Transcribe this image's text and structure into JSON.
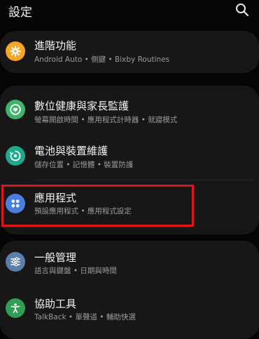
{
  "header": {
    "title": "設定",
    "search_icon": "search-icon"
  },
  "items": [
    {
      "label": "進階功能",
      "sub": "Android Auto • 側鍵 • Bixby Routines",
      "icon": "star-gear-icon",
      "color": "#f6a623"
    },
    {
      "label": "數位健康與家長監護",
      "sub": "螢幕開啟時間 • 應用程式計時器 • 就寢模式",
      "icon": "heart-circle-icon",
      "color": "#3db56a"
    },
    {
      "label": "電池與裝置維護",
      "sub": "儲存位置 • 記憶體 • 裝置防護",
      "icon": "device-care-icon",
      "color": "#1fa88b"
    },
    {
      "label": "應用程式",
      "sub": "預設應用程式 • 應用程式設定",
      "icon": "apps-grid-icon",
      "color": "#4a7fe0"
    },
    {
      "label": "一般管理",
      "sub": "語言與鍵盤 • 日期與時間",
      "icon": "sliders-icon",
      "color": "#5a7fa8"
    },
    {
      "label": "協助工具",
      "sub": "TalkBack • 單聲道 • 輔助快選",
      "icon": "accessibility-icon",
      "color": "#2f9e52"
    }
  ],
  "highlight_color": "#e0141b"
}
